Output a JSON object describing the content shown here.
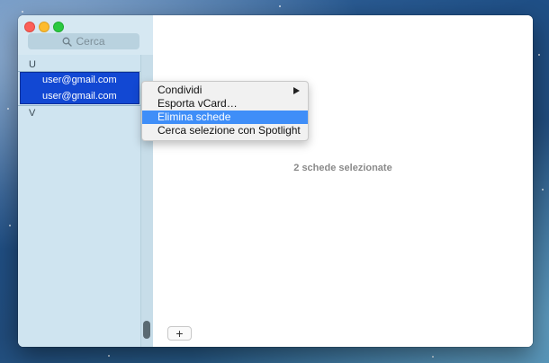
{
  "sidebar": {
    "search_placeholder": "Cerca",
    "sections": [
      {
        "letter": "U"
      },
      {
        "letter": "V"
      }
    ],
    "contacts": [
      {
        "label": "user@gmail.com"
      },
      {
        "label": "user@gmail.com"
      }
    ]
  },
  "main": {
    "status": "2 schede selezionate",
    "add_label": "+"
  },
  "context_menu": {
    "items": [
      {
        "label": "Condividi",
        "submenu": true
      },
      {
        "label": "Esporta vCard…"
      },
      {
        "label": "Elimina schede",
        "highlighted": true
      },
      {
        "label": "Cerca selezione con Spotlight"
      }
    ]
  },
  "colors": {
    "selection": "#1248d3",
    "menu_highlight": "#3f8ef8",
    "sidebar_bg": "#cfe4f0"
  }
}
